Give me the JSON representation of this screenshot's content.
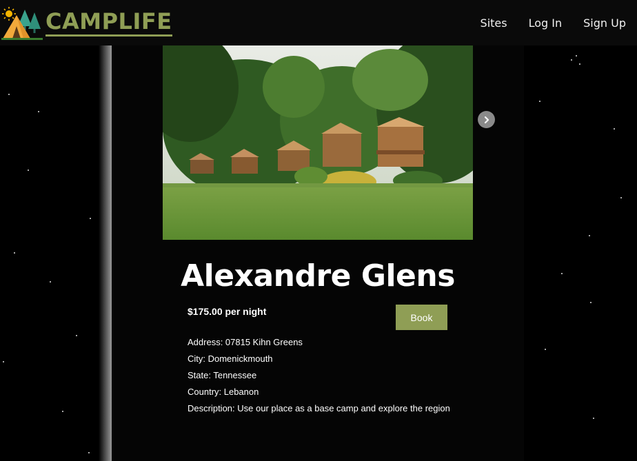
{
  "navbar": {
    "brand": "CAMPLIFE",
    "links": [
      {
        "label": "Sites"
      },
      {
        "label": "Log In"
      },
      {
        "label": "Sign Up"
      }
    ]
  },
  "site": {
    "name": "Alexandre Glens",
    "price": "$175.00 per night",
    "book_label": "Book",
    "details": [
      "Address: 07815 Kihn Greens",
      "City: Domenickmouth",
      "State: Tennessee",
      "Country: Lebanon",
      "Description: Use our place as a base camp and explore the region"
    ]
  },
  "colors": {
    "accent": "#8f9e55",
    "background": "#000000",
    "navbar": "#0a0a0a"
  },
  "icons": {
    "logo": "sun-tent-trees-logo",
    "carousel_next": "chevron-right-icon"
  }
}
